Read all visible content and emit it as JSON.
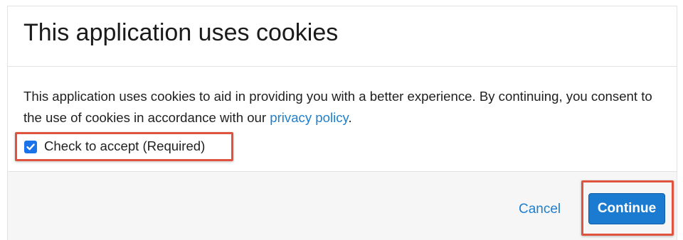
{
  "dialog": {
    "title": "This application uses cookies",
    "body_text": "This application uses cookies to aid in providing you with a better experience. By continuing, you consent to the use of cookies in accordance with our ",
    "privacy_link": "privacy policy",
    "body_text_end": ".",
    "accept_checkbox": {
      "label": "Check to accept (Required)",
      "checked": true
    },
    "cancel_label": "Cancel",
    "continue_label": "Continue"
  },
  "colors": {
    "accent": "#1a7bd1",
    "link": "#1d7fcf",
    "highlight": "#e0533e",
    "footer_bg": "#f6f6f6"
  },
  "icons": {
    "checkbox": "checkmark-icon"
  }
}
